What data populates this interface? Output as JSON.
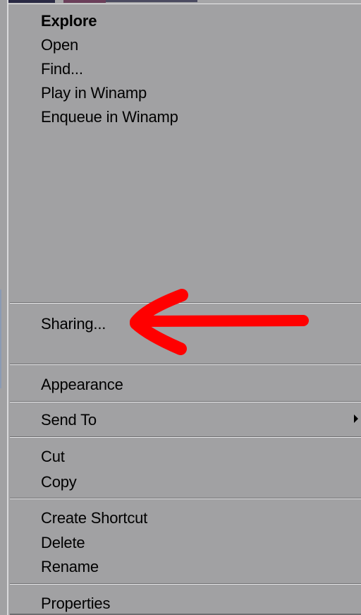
{
  "menu": {
    "group1": [
      {
        "label": "Explore",
        "bold": true
      },
      {
        "label": "Open"
      },
      {
        "label": "Find..."
      },
      {
        "label": "Play in Winamp"
      },
      {
        "label": "Enqueue in Winamp"
      }
    ],
    "sharing": "Sharing...",
    "appearance": "Appearance",
    "send_to": "Send To",
    "group_edit": [
      {
        "label": "Cut"
      },
      {
        "label": "Copy"
      }
    ],
    "group_file": [
      {
        "label": "Create Shortcut"
      },
      {
        "label": "Delete"
      },
      {
        "label": "Rename"
      }
    ],
    "properties": "Properties"
  },
  "annotation": {
    "type": "red-arrow",
    "points_to": "Sharing...",
    "color": "#ff0000"
  },
  "colors": {
    "menu_bg": "#a1a1a3",
    "text": "#000000"
  }
}
